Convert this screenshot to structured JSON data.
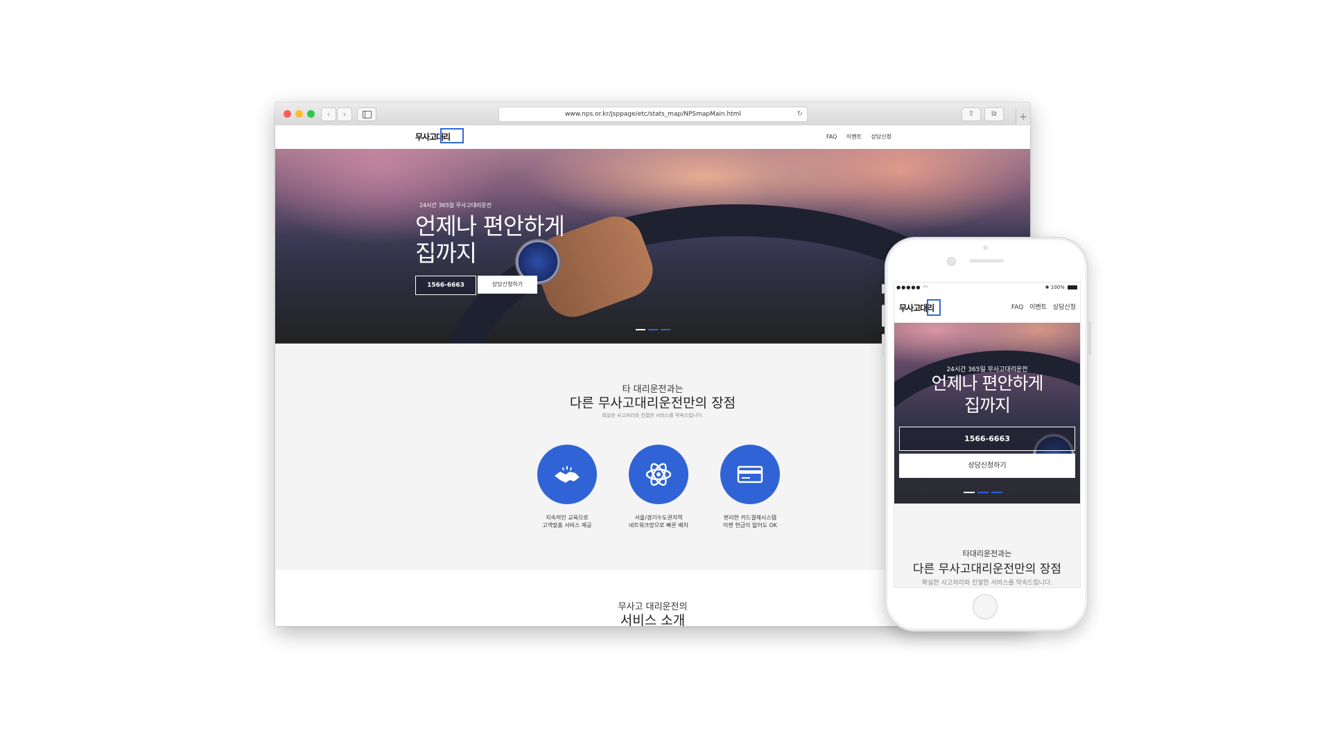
{
  "colors": {
    "accent": "#2f63d6",
    "hero_dark": "#2b2d3c",
    "section_bg": "#f4f4f4"
  },
  "browser": {
    "url": "www.nps.or.kr/jsppage/etc/stats_map/NPSmapMain.html",
    "back_icon": "‹",
    "forward_icon": "›",
    "reload_icon": "↻",
    "share_icon": "⇧",
    "tabs_icon": "⧉",
    "new_tab_icon": "+"
  },
  "site": {
    "logo": "무사고대리",
    "nav": [
      "FAQ",
      "이벤트",
      "상담신청"
    ],
    "hero": {
      "subtitle": "24시간 365일 무사고대리운전",
      "title_line1": "언제나 편안하게",
      "title_line2": "집까지",
      "phone_button": "1566-6663",
      "consult_button": "상담신청하기"
    },
    "advantages": {
      "small_title": "타 대리운전과는",
      "title": "다른 무사고대리운전만의 장점",
      "description": "확실한 사고처리와 친절한 서비스를 약속드립니다.",
      "features": [
        {
          "icon": "handshake-icon",
          "line1": "지속적인 교육으로",
          "line2": "고객맞춤 서비스 제공"
        },
        {
          "icon": "atom-network-icon",
          "line1": "서울/경기수도권지역",
          "line2": "네트워크망으로 빠른 배차"
        },
        {
          "icon": "credit-card-icon",
          "line1": "편리한 카드결제시스템",
          "line2": "이젠 현금이 없어도 OK"
        }
      ]
    },
    "services": {
      "small_title": "무사고 대리운전의",
      "title": "서비스 소개"
    }
  },
  "mobile": {
    "status_signal": "●●●●● ◠",
    "status_right": "✱ 100%",
    "logo": "무사고대리",
    "nav": [
      "FAQ",
      "이벤트",
      "상담신청"
    ],
    "hero": {
      "subtitle": "24시간 365일 무사고대리운전",
      "title_line1": "언제나 편안하게",
      "title_line2": "집까지",
      "phone_button": "1566-6663",
      "consult_button": "상담신청하기"
    },
    "advantages": {
      "small_title": "타대리운전과는",
      "title": "다른 무사고대리운전만의 장점",
      "description": "확실한 사고처리와 친절한 서비스를 약속드립니다."
    }
  }
}
